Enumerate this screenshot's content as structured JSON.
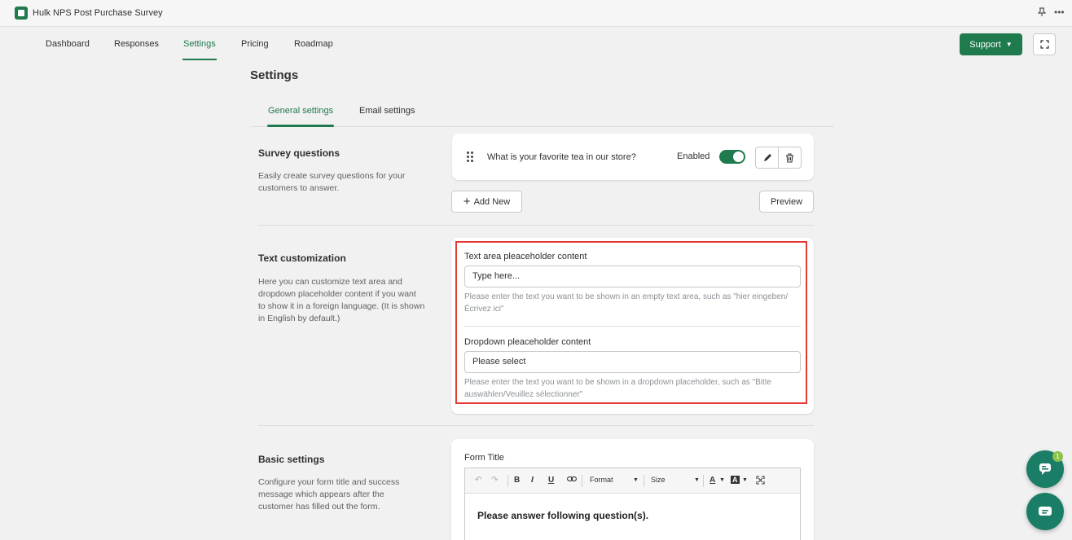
{
  "app": {
    "title": "Hulk NPS Post Purchase Survey"
  },
  "nav": {
    "items": [
      "Dashboard",
      "Responses",
      "Settings",
      "Pricing",
      "Roadmap"
    ],
    "active": "Settings",
    "support_label": "Support"
  },
  "page": {
    "title": "Settings"
  },
  "tabs": {
    "items": [
      "General settings",
      "Email settings"
    ],
    "active": "General settings"
  },
  "survey_questions": {
    "heading": "Survey questions",
    "description": "Easily create survey questions for your customers to answer.",
    "question": "What is your favorite tea in our store?",
    "status_label": "Enabled",
    "enabled": true,
    "add_new_label": "Add New",
    "preview_label": "Preview"
  },
  "text_customization": {
    "heading": "Text customization",
    "description": "Here you can customize text area and dropdown placeholder content if you want to show it in a foreign language. (It is shown in English by default.)",
    "textarea_label": "Text area pleaceholder content",
    "textarea_value": "Type here...",
    "textarea_help": "Please enter the text you want to be shown in an empty text area, such as \"hier eingeben/Écrivez ici\"",
    "dropdown_label": "Dropdown pleaceholder content",
    "dropdown_value": "Please select",
    "dropdown_help": "Please enter the text you want to be shown in a dropdown placeholder, such as \"Bitte auswählen/Veuillez sélectionner\""
  },
  "basic_settings": {
    "heading": "Basic settings",
    "description": "Configure your form title and success message which appears after the customer has filled out the form.",
    "form_title_label": "Form Title",
    "toolbar": {
      "bold": "B",
      "italic": "I",
      "underline": "U",
      "format": "Format",
      "size": "Size",
      "font_color": "A",
      "bg_color": "A"
    },
    "editor_content": "Please answer following question(s)."
  },
  "chat": {
    "badge_count": "1"
  },
  "colors": {
    "accent": "#1f7a4d",
    "highlight": "#e53935",
    "chat": "#1a7d66"
  }
}
